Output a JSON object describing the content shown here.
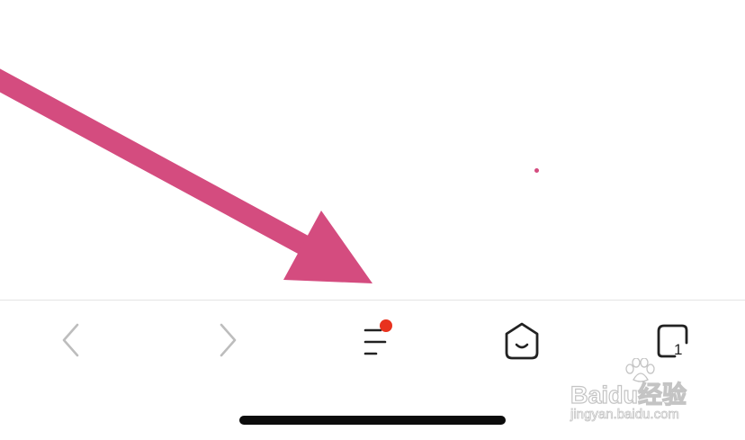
{
  "annotation": {
    "arrow_color": "#d44c7f",
    "dot_color": "#d44c7f"
  },
  "toolbar": {
    "back": {
      "icon": "chevron-left-icon",
      "enabled": false
    },
    "forward": {
      "icon": "chevron-right-icon",
      "enabled": false
    },
    "menu": {
      "icon": "menu-lines-icon",
      "has_notification": true,
      "badge_color": "#e8321e"
    },
    "home": {
      "icon": "home-icon"
    },
    "tabs": {
      "icon": "tabs-icon",
      "count": "1"
    },
    "icon_color": "#222222",
    "disabled_color": "#bdbdbd"
  },
  "watermark": {
    "brand": "Baidu经验",
    "url": "jingyan.baidu.com"
  }
}
